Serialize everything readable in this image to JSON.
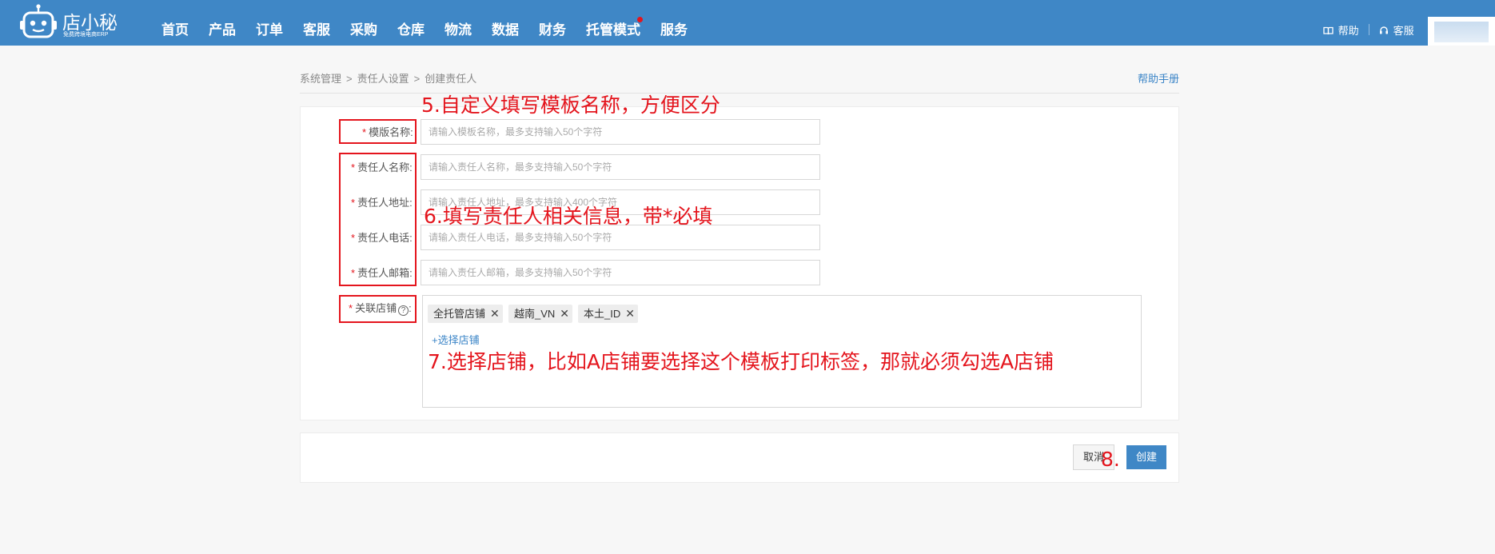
{
  "header": {
    "logo_name": "店小秘",
    "logo_slogan": "免费跨境电商ERP",
    "nav": [
      "首页",
      "产品",
      "订单",
      "客服",
      "采购",
      "仓库",
      "物流",
      "数据",
      "财务",
      "托管模式",
      "服务"
    ],
    "help_label": "帮助",
    "service_label": "客服"
  },
  "breadcrumb": {
    "items": [
      "系统管理",
      ">",
      "责任人设置",
      ">",
      "创建责任人"
    ],
    "help_manual": "帮助手册"
  },
  "form": {
    "template_name": {
      "label": "模版名称:",
      "placeholder": "请输入模板名称，最多支持输入50个字符"
    },
    "responsible_name": {
      "label": "责任人名称:",
      "placeholder": "请输入责任人名称，最多支持输入50个字符"
    },
    "responsible_address": {
      "label": "责任人地址:",
      "placeholder": "请输入责任人地址，最多支持输入400个字符"
    },
    "responsible_phone": {
      "label": "责任人电话:",
      "placeholder": "请输入责任人电话，最多支持输入50个字符"
    },
    "responsible_email": {
      "label": "责任人邮箱:",
      "placeholder": "请输入责任人邮箱，最多支持输入50个字符"
    },
    "stores": {
      "label": "关联店铺",
      "help": "?",
      "colon": ":",
      "tags": [
        "全托管店铺",
        "越南_VN",
        "本土_ID"
      ],
      "select_label": "+选择店铺"
    },
    "required_mark": "*"
  },
  "annotations": {
    "step5": "5.自定义填写模板名称，方便区分",
    "step6": "6.填写责任人相关信息，带*必填",
    "step7": "7.选择店铺，比如A店铺要选择这个模板打印标签，那就必须勾选A店铺",
    "step8": "8."
  },
  "buttons": {
    "cancel": "取消",
    "create": "创建"
  },
  "colors": {
    "header_bg": "#3f87c6",
    "annotation_red": "#e4151d",
    "link_blue": "#3a84c7"
  }
}
